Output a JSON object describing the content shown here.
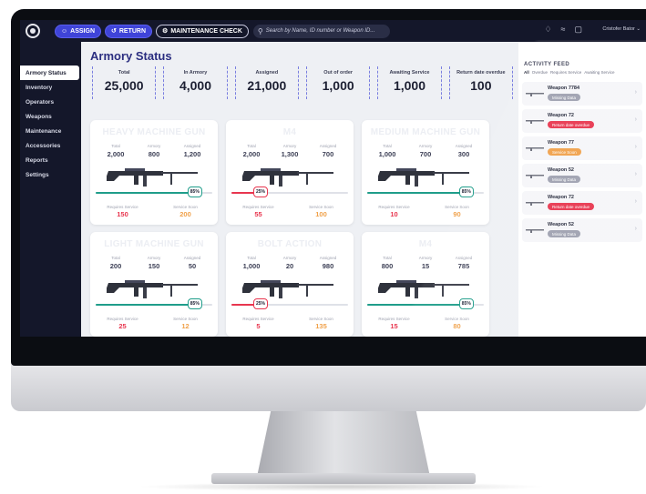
{
  "topbar": {
    "assign_label": "ASSIGN",
    "return_label": "RETURN",
    "maintenance_label": "MAINTENANCE CHECK",
    "search_placeholder": "Search by Name, ID number or Weapon ID...",
    "user_name": "Cristofer Bator"
  },
  "sidebar": {
    "items": [
      {
        "label": "Armory Status"
      },
      {
        "label": "Inventory"
      },
      {
        "label": "Operators"
      },
      {
        "label": "Weapons"
      },
      {
        "label": "Maintenance"
      },
      {
        "label": "Accessories"
      },
      {
        "label": "Reports"
      },
      {
        "label": "Settings"
      }
    ]
  },
  "main": {
    "title": "Armory Status",
    "stats": [
      {
        "label": "Total",
        "value": "25,000"
      },
      {
        "label": "In Armory",
        "value": "4,000"
      },
      {
        "label": "Assigned",
        "value": "21,000"
      },
      {
        "label": "Out of order",
        "value": "1,000"
      },
      {
        "label": "Awaiting Service",
        "value": "1,000"
      },
      {
        "label": "Return date overdue",
        "value": "100"
      }
    ],
    "col_labels": {
      "total": "Total",
      "armory": "Armory",
      "assigned": "Assigned"
    },
    "foot_labels": {
      "requires": "Requires Service",
      "soon": "Service Soon"
    },
    "cards": [
      {
        "title": "HEAVY MACHINE GUN",
        "total": "2,000",
        "armory": "800",
        "assigned": "1,200",
        "percent": "85%",
        "fill": 0.85,
        "bar_color": "#1f9d8a",
        "requires": "150",
        "soon": "200"
      },
      {
        "title": "M4",
        "total": "2,000",
        "armory": "1,300",
        "assigned": "700",
        "percent": "25%",
        "fill": 0.25,
        "bar_color": "#e8364f",
        "requires": "55",
        "soon": "100"
      },
      {
        "title": "MEDIUM MACHINE GUN",
        "total": "1,000",
        "armory": "700",
        "assigned": "300",
        "percent": "85%",
        "fill": 0.85,
        "bar_color": "#1f9d8a",
        "requires": "10",
        "soon": "90"
      },
      {
        "title": "LIGHT MACHINE GUN",
        "total": "200",
        "armory": "150",
        "assigned": "50",
        "percent": "85%",
        "fill": 0.85,
        "bar_color": "#1f9d8a",
        "requires": "25",
        "soon": "12"
      },
      {
        "title": "BOLT ACTION",
        "total": "1,000",
        "armory": "20",
        "assigned": "980",
        "percent": "25%",
        "fill": 0.25,
        "bar_color": "#e8364f",
        "requires": "5",
        "soon": "135"
      },
      {
        "title": "M4",
        "total": "800",
        "armory": "15",
        "assigned": "785",
        "percent": "85%",
        "fill": 0.85,
        "bar_color": "#1f9d8a",
        "requires": "15",
        "soon": "80"
      }
    ]
  },
  "feed": {
    "title": "ACTIVITY FEED",
    "tabs": [
      "All",
      "Overdue",
      "Requires Service",
      "Awaiting Service"
    ],
    "items": [
      {
        "name": "Weapon 7784",
        "badge": "Missing Data",
        "badge_color": "#9ea1b0"
      },
      {
        "name": "Weapon 72",
        "badge": "Return date overdue",
        "badge_color": "#e8364f"
      },
      {
        "name": "Weapon 77",
        "badge": "Service Soon",
        "badge_color": "#f0a14a"
      },
      {
        "name": "Weapon 52",
        "badge": "Missing Data",
        "badge_color": "#9ea1b0"
      },
      {
        "name": "Weapon 72",
        "badge": "Return date overdue",
        "badge_color": "#e8364f"
      },
      {
        "name": "Weapon 52",
        "badge": "Missing Data",
        "badge_color": "#9ea1b0"
      }
    ]
  }
}
